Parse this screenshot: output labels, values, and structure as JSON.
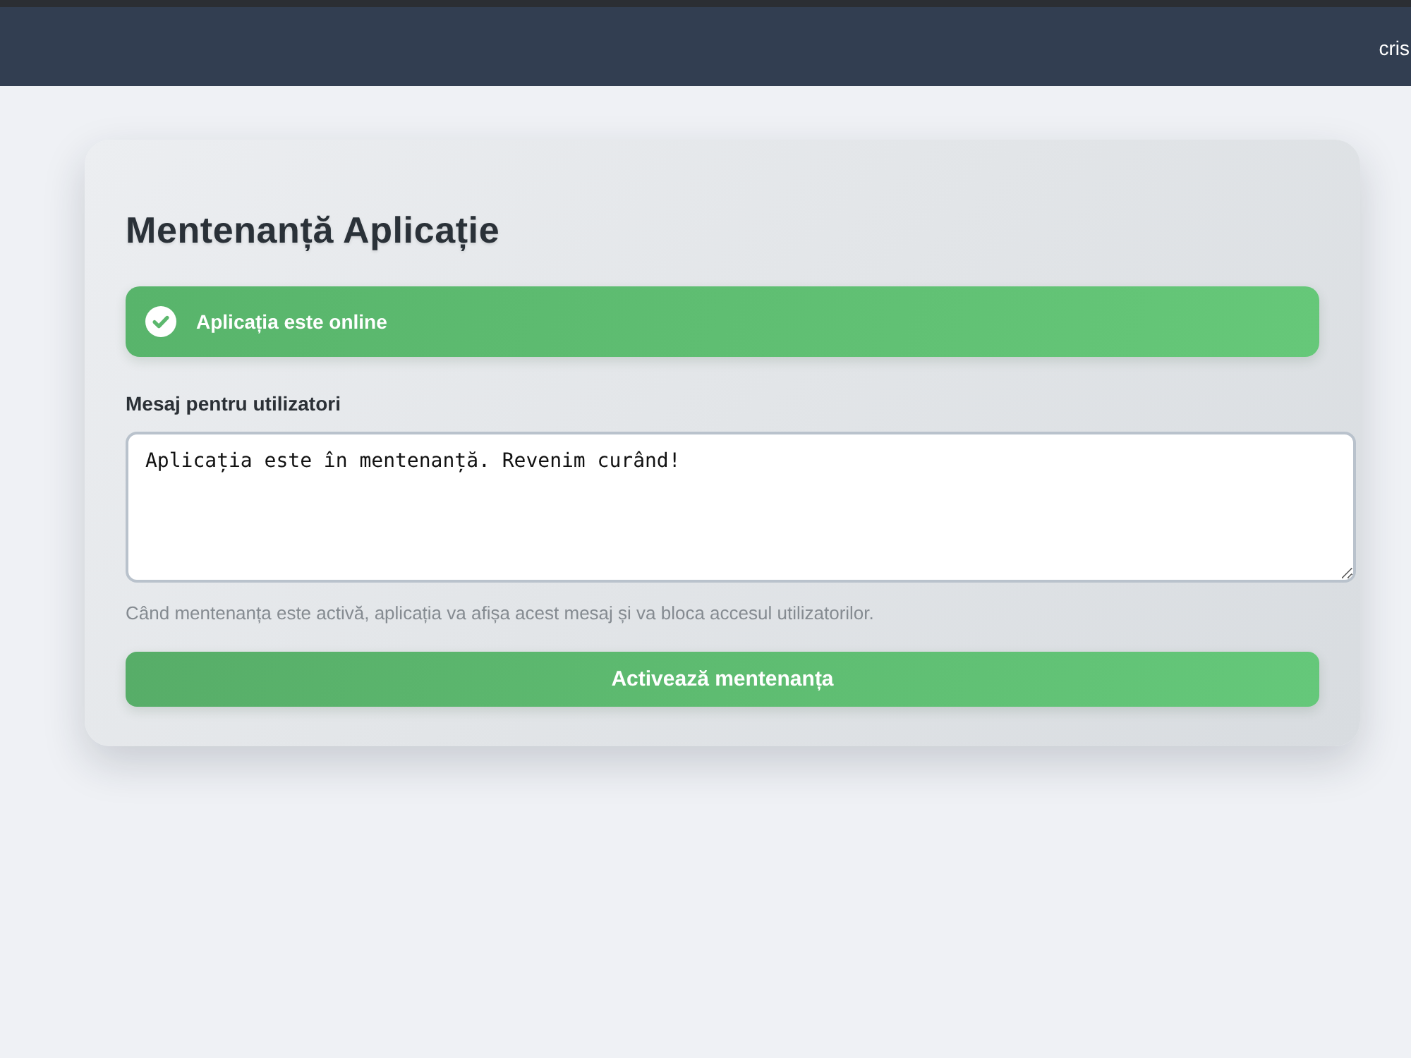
{
  "header": {
    "user": "cris"
  },
  "card": {
    "title": "Mentenanță Aplicație",
    "status": {
      "kind": "online",
      "text": "Aplicația este online"
    },
    "message_field": {
      "label": "Mesaj pentru utilizatori",
      "value": "Aplicația este în mentenanță. Revenim curând!"
    },
    "hint": "Când mentenanța este activă, aplicația va afișa acest mesaj și va bloca accesul utilizatorilor.",
    "button": "Activează mentenanța"
  }
}
